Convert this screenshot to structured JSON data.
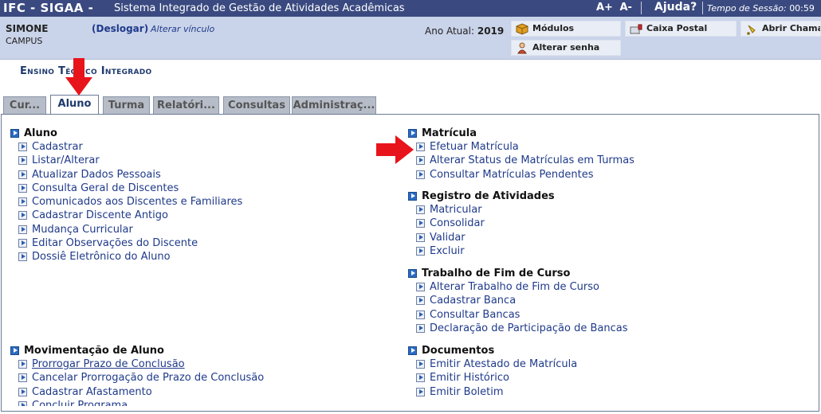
{
  "topbar": {
    "brand": "IFC - SIGAA -",
    "system_name": "Sistema Integrado de Gestão de Atividades Acadêmicas",
    "font_increase": "A+",
    "font_decrease": "A-",
    "help": "Ajuda?",
    "session_label": "Tempo de Sessão:",
    "session_time": "00:59"
  },
  "user": {
    "name": "SIMONE",
    "campus": "CAMPUS",
    "logout": "(Deslogar)",
    "change_link": "Alterar vínculo",
    "year_label": "Ano Atual:",
    "year_value": "2019"
  },
  "quick_buttons": {
    "modulos": "Módulos",
    "caixa_postal": "Caixa Postal",
    "abrir_chamado": "Abrir Chamado",
    "alterar_senha": "Alterar senha"
  },
  "section_title": "Ensino Técnico Integrado",
  "tabs": [
    {
      "label": "Cur..."
    },
    {
      "label": "Aluno",
      "active": true
    },
    {
      "label": "Turma"
    },
    {
      "label": "Relatóri..."
    },
    {
      "label": "Consultas"
    },
    {
      "label": "Administraç..."
    }
  ],
  "groups": {
    "aluno": {
      "title": "Aluno",
      "items": [
        "Cadastrar",
        "Listar/Alterar",
        "Atualizar Dados Pessoais",
        "Consulta Geral de Discentes",
        "Comunicados aos Discentes e Familiares",
        "Cadastrar Discente Antigo",
        "Mudança Curricular",
        "Editar Observações do Discente",
        "Dossiê Eletrônico do Aluno"
      ]
    },
    "movimentacao": {
      "title": "Movimentação de Aluno",
      "items": [
        "Prorrogar Prazo de Conclusão",
        "Cancelar Prorrogação de Prazo de Conclusão",
        "Cadastrar Afastamento",
        "Concluir Programa"
      ]
    },
    "matricula": {
      "title": "Matrícula",
      "items": [
        "Efetuar Matrícula",
        "Alterar Status de Matrículas em Turmas",
        "Consultar Matrículas Pendentes"
      ]
    },
    "registro": {
      "title": "Registro de Atividades",
      "items": [
        "Matricular",
        "Consolidar",
        "Validar",
        "Excluir"
      ]
    },
    "tcc": {
      "title": "Trabalho de Fim de Curso",
      "items": [
        "Alterar Trabalho de Fim de Curso",
        "Cadastrar Banca",
        "Consultar Bancas",
        "Declaração de Participação de Bancas"
      ]
    },
    "documentos": {
      "title": "Documentos",
      "items": [
        "Emitir Atestado de Matrícula",
        "Emitir Histórico",
        "Emitir Boletim"
      ]
    }
  },
  "colors": {
    "topbar_bg": "#3a4a80",
    "infobar_bg": "#c9d3e9",
    "link": "#1f3a8a",
    "annotation_arrow": "#e8141b"
  }
}
